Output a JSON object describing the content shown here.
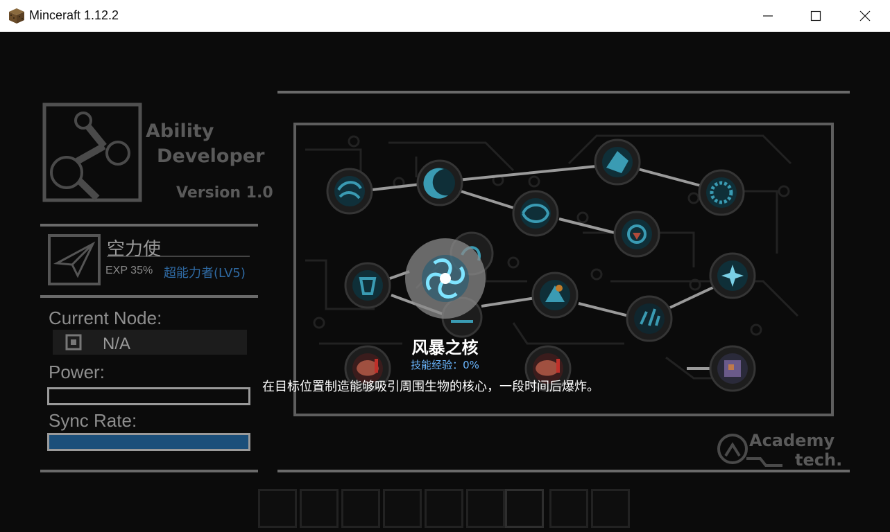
{
  "window": {
    "title": "Minceraft 1.12.2",
    "icon": "grass-block-icon",
    "controls": [
      "minimize-icon",
      "maximize-icon",
      "close-icon"
    ]
  },
  "logo": {
    "line1": "Ability",
    "line2": "Developer",
    "version": "Version 1.0"
  },
  "category": {
    "name": "空力使",
    "exp": "EXP 35%",
    "level": "超能力者(LV5)",
    "icon": "paper-plane-icon"
  },
  "status": {
    "current_node_label": "Current Node:",
    "current_node_value": "N/A",
    "power_label": "Power:",
    "sync_label": "Sync Rate:",
    "power_fill": 0,
    "sync_fill": 1.0
  },
  "skill": {
    "name": "风暴之核",
    "exp": "技能经验：0%",
    "description": "在目标位置制造能够吸引周围生物的核心，一段时间后爆炸。"
  },
  "brand": {
    "line1": "Academy",
    "line2": "tech."
  },
  "colors": {
    "background": "#0b0b0b",
    "accent_blue": "#1b4f7a",
    "link_blue": "#2f6aa3",
    "skill_exp_blue": "#6bb7ff"
  }
}
